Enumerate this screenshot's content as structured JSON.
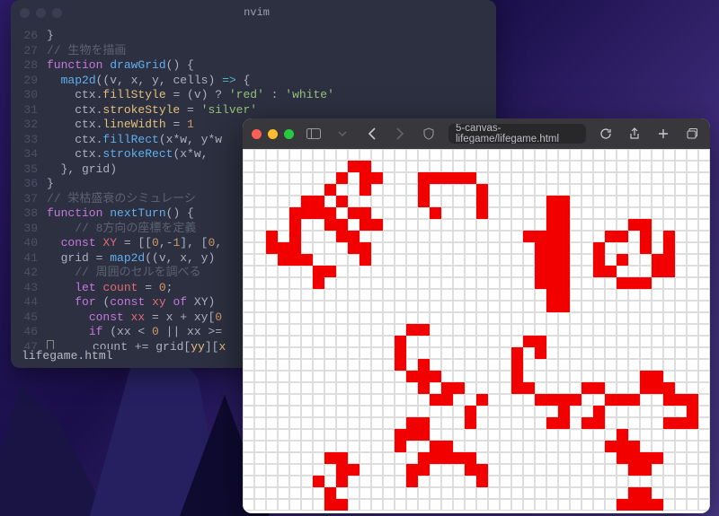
{
  "editor": {
    "title": "nvim",
    "statusbar": "lifegame.html",
    "lines": [
      {
        "n": 26,
        "tokens": [
          [
            "pun",
            "}"
          ]
        ]
      },
      {
        "n": 27,
        "tokens": [
          [
            "cmt",
            "// 生物を描画"
          ]
        ]
      },
      {
        "n": 28,
        "tokens": [
          [
            "kw",
            "function "
          ],
          [
            "fn",
            "drawGrid"
          ],
          [
            "pun",
            "() {"
          ]
        ]
      },
      {
        "n": 29,
        "tokens": [
          [
            "pun",
            "  "
          ],
          [
            "fn",
            "map2d"
          ],
          [
            "pun",
            "((v, x, y, cells) "
          ],
          [
            "op",
            "=>"
          ],
          [
            "pun",
            " {"
          ]
        ]
      },
      {
        "n": 30,
        "tokens": [
          [
            "pun",
            "    ctx."
          ],
          [
            "prop",
            "fillStyle"
          ],
          [
            "pun",
            " = (v) ? "
          ],
          [
            "str",
            "'red'"
          ],
          [
            "pun",
            " : "
          ],
          [
            "str",
            "'white'"
          ]
        ]
      },
      {
        "n": 31,
        "tokens": [
          [
            "pun",
            "    ctx."
          ],
          [
            "prop",
            "strokeStyle"
          ],
          [
            "pun",
            " = "
          ],
          [
            "str",
            "'silver'"
          ]
        ]
      },
      {
        "n": 32,
        "tokens": [
          [
            "pun",
            "    ctx."
          ],
          [
            "prop",
            "lineWidth"
          ],
          [
            "pun",
            " = "
          ],
          [
            "num",
            "1"
          ]
        ]
      },
      {
        "n": 33,
        "tokens": [
          [
            "pun",
            "    ctx."
          ],
          [
            "fn",
            "fillRect"
          ],
          [
            "pun",
            "(x*w, y*w"
          ]
        ]
      },
      {
        "n": 34,
        "tokens": [
          [
            "pun",
            "    ctx."
          ],
          [
            "fn",
            "strokeRect"
          ],
          [
            "pun",
            "(x*w,"
          ]
        ]
      },
      {
        "n": 35,
        "tokens": [
          [
            "pun",
            "  }, grid)"
          ]
        ]
      },
      {
        "n": 36,
        "tokens": [
          [
            "pun",
            "}"
          ]
        ]
      },
      {
        "n": 37,
        "tokens": [
          [
            "cmt",
            "// 栄枯盛衰のシミュレーシ"
          ]
        ]
      },
      {
        "n": 38,
        "tokens": [
          [
            "kw",
            "function "
          ],
          [
            "fn",
            "nextTurn"
          ],
          [
            "pun",
            "() {"
          ]
        ]
      },
      {
        "n": 39,
        "tokens": [
          [
            "pun",
            "    "
          ],
          [
            "cmt",
            "// 8方向の座標を定義"
          ]
        ]
      },
      {
        "n": 40,
        "tokens": [
          [
            "pun",
            "  "
          ],
          [
            "kw",
            "const "
          ],
          [
            "var",
            "XY"
          ],
          [
            "pun",
            " = [["
          ],
          [
            "num",
            "0"
          ],
          [
            "pun",
            ",-"
          ],
          [
            "num",
            "1"
          ],
          [
            "pun",
            "], ["
          ],
          [
            "num",
            "0"
          ],
          [
            "pun",
            ","
          ]
        ]
      },
      {
        "n": 41,
        "tokens": [
          [
            "pun",
            "  grid = "
          ],
          [
            "fn",
            "map2d"
          ],
          [
            "pun",
            "((v, x, y)"
          ]
        ]
      },
      {
        "n": 42,
        "tokens": [
          [
            "pun",
            "    "
          ],
          [
            "cmt",
            "// 周囲のセルを調べる"
          ]
        ]
      },
      {
        "n": 43,
        "tokens": [
          [
            "pun",
            "    "
          ],
          [
            "kw",
            "let "
          ],
          [
            "var",
            "count"
          ],
          [
            "pun",
            " = "
          ],
          [
            "num",
            "0"
          ],
          [
            "pun",
            ";"
          ]
        ]
      },
      {
        "n": 44,
        "tokens": [
          [
            "pun",
            "    "
          ],
          [
            "kw",
            "for "
          ],
          [
            "pun",
            "("
          ],
          [
            "kw",
            "const "
          ],
          [
            "var",
            "xy"
          ],
          [
            "pun",
            " "
          ],
          [
            "kw",
            "of"
          ],
          [
            "pun",
            " XY)"
          ]
        ]
      },
      {
        "n": 45,
        "tokens": [
          [
            "pun",
            "      "
          ],
          [
            "kw",
            "const "
          ],
          [
            "var",
            "xx"
          ],
          [
            "pun",
            " = x + xy["
          ],
          [
            "num",
            "0"
          ]
        ]
      },
      {
        "n": 46,
        "tokens": [
          [
            "pun",
            "      "
          ],
          [
            "kw",
            "if "
          ],
          [
            "pun",
            "(xx < "
          ],
          [
            "num",
            "0"
          ],
          [
            "pun",
            " || xx >="
          ]
        ]
      },
      {
        "n": 47,
        "tokens": [
          [
            "cursor",
            ""
          ],
          [
            "pun",
            "     count += grid["
          ],
          [
            "prop",
            "yy"
          ],
          [
            "pun",
            "]["
          ],
          [
            "prop",
            "x"
          ]
        ]
      }
    ]
  },
  "browser": {
    "url": "5-canvas-lifegame/lifegame.html",
    "grid_cols": 40,
    "alive": [
      [
        1,
        9
      ],
      [
        1,
        10
      ],
      [
        2,
        8
      ],
      [
        2,
        10
      ],
      [
        2,
        11
      ],
      [
        2,
        15
      ],
      [
        2,
        16
      ],
      [
        2,
        17
      ],
      [
        2,
        18
      ],
      [
        2,
        19
      ],
      [
        3,
        7
      ],
      [
        3,
        10
      ],
      [
        3,
        15
      ],
      [
        3,
        20
      ],
      [
        4,
        5
      ],
      [
        4,
        6
      ],
      [
        4,
        8
      ],
      [
        4,
        15
      ],
      [
        4,
        20
      ],
      [
        4,
        26
      ],
      [
        4,
        27
      ],
      [
        5,
        4
      ],
      [
        5,
        5
      ],
      [
        5,
        6
      ],
      [
        5,
        7
      ],
      [
        5,
        9
      ],
      [
        5,
        10
      ],
      [
        5,
        16
      ],
      [
        5,
        20
      ],
      [
        5,
        26
      ],
      [
        5,
        27
      ],
      [
        6,
        4
      ],
      [
        6,
        7
      ],
      [
        6,
        8
      ],
      [
        6,
        10
      ],
      [
        6,
        11
      ],
      [
        6,
        26
      ],
      [
        6,
        27
      ],
      [
        6,
        33
      ],
      [
        6,
        34
      ],
      [
        7,
        2
      ],
      [
        7,
        4
      ],
      [
        7,
        8
      ],
      [
        7,
        9
      ],
      [
        7,
        24
      ],
      [
        7,
        25
      ],
      [
        7,
        26
      ],
      [
        7,
        27
      ],
      [
        7,
        31
      ],
      [
        7,
        32
      ],
      [
        7,
        34
      ],
      [
        7,
        36
      ],
      [
        8,
        2
      ],
      [
        8,
        3
      ],
      [
        8,
        4
      ],
      [
        8,
        9
      ],
      [
        8,
        10
      ],
      [
        8,
        25
      ],
      [
        8,
        26
      ],
      [
        8,
        27
      ],
      [
        8,
        30
      ],
      [
        8,
        34
      ],
      [
        8,
        36
      ],
      [
        9,
        3
      ],
      [
        9,
        4
      ],
      [
        9,
        5
      ],
      [
        9,
        10
      ],
      [
        9,
        25
      ],
      [
        9,
        26
      ],
      [
        9,
        27
      ],
      [
        9,
        30
      ],
      [
        9,
        32
      ],
      [
        9,
        35
      ],
      [
        9,
        36
      ],
      [
        10,
        6
      ],
      [
        10,
        7
      ],
      [
        10,
        25
      ],
      [
        10,
        26
      ],
      [
        10,
        27
      ],
      [
        10,
        30
      ],
      [
        10,
        31
      ],
      [
        10,
        35
      ],
      [
        10,
        36
      ],
      [
        11,
        6
      ],
      [
        11,
        25
      ],
      [
        11,
        26
      ],
      [
        11,
        27
      ],
      [
        11,
        32
      ],
      [
        11,
        33
      ],
      [
        11,
        34
      ],
      [
        12,
        26
      ],
      [
        12,
        27
      ],
      [
        13,
        26
      ],
      [
        13,
        27
      ],
      [
        15,
        14
      ],
      [
        15,
        15
      ],
      [
        16,
        13
      ],
      [
        16,
        24
      ],
      [
        16,
        25
      ],
      [
        17,
        13
      ],
      [
        17,
        23
      ],
      [
        17,
        25
      ],
      [
        18,
        13
      ],
      [
        18,
        15
      ],
      [
        18,
        23
      ],
      [
        19,
        14
      ],
      [
        19,
        15
      ],
      [
        19,
        16
      ],
      [
        19,
        23
      ],
      [
        19,
        34
      ],
      [
        19,
        35
      ],
      [
        20,
        15
      ],
      [
        20,
        17
      ],
      [
        20,
        18
      ],
      [
        20,
        23
      ],
      [
        20,
        24
      ],
      [
        20,
        29
      ],
      [
        20,
        30
      ],
      [
        20,
        34
      ],
      [
        20,
        35
      ],
      [
        20,
        36
      ],
      [
        21,
        16
      ],
      [
        21,
        17
      ],
      [
        21,
        20
      ],
      [
        21,
        25
      ],
      [
        21,
        26
      ],
      [
        21,
        27
      ],
      [
        21,
        28
      ],
      [
        21,
        31
      ],
      [
        21,
        32
      ],
      [
        21,
        33
      ],
      [
        21,
        36
      ],
      [
        21,
        37
      ],
      [
        21,
        38
      ],
      [
        22,
        19
      ],
      [
        22,
        27
      ],
      [
        22,
        30
      ],
      [
        22,
        38
      ],
      [
        23,
        14
      ],
      [
        23,
        15
      ],
      [
        23,
        19
      ],
      [
        23,
        26
      ],
      [
        23,
        27
      ],
      [
        23,
        29
      ],
      [
        23,
        30
      ],
      [
        23,
        36
      ],
      [
        23,
        37
      ],
      [
        23,
        38
      ],
      [
        24,
        13
      ],
      [
        24,
        14
      ],
      [
        24,
        15
      ],
      [
        24,
        32
      ],
      [
        25,
        13
      ],
      [
        25,
        16
      ],
      [
        25,
        17
      ],
      [
        25,
        31
      ],
      [
        25,
        32
      ],
      [
        25,
        33
      ],
      [
        26,
        7
      ],
      [
        26,
        8
      ],
      [
        26,
        15
      ],
      [
        26,
        16
      ],
      [
        26,
        17
      ],
      [
        26,
        18
      ],
      [
        26,
        19
      ],
      [
        26,
        32
      ],
      [
        26,
        33
      ],
      [
        26,
        34
      ],
      [
        26,
        35
      ],
      [
        27,
        8
      ],
      [
        27,
        9
      ],
      [
        27,
        14
      ],
      [
        27,
        15
      ],
      [
        27,
        19
      ],
      [
        27,
        20
      ],
      [
        27,
        33
      ],
      [
        27,
        34
      ],
      [
        28,
        6
      ],
      [
        28,
        8
      ],
      [
        28,
        14
      ],
      [
        28,
        20
      ],
      [
        29,
        7
      ],
      [
        29,
        33
      ],
      [
        29,
        34
      ],
      [
        30,
        7
      ],
      [
        30,
        8
      ],
      [
        30,
        32
      ],
      [
        30,
        33
      ],
      [
        30,
        34
      ],
      [
        30,
        35
      ]
    ]
  }
}
